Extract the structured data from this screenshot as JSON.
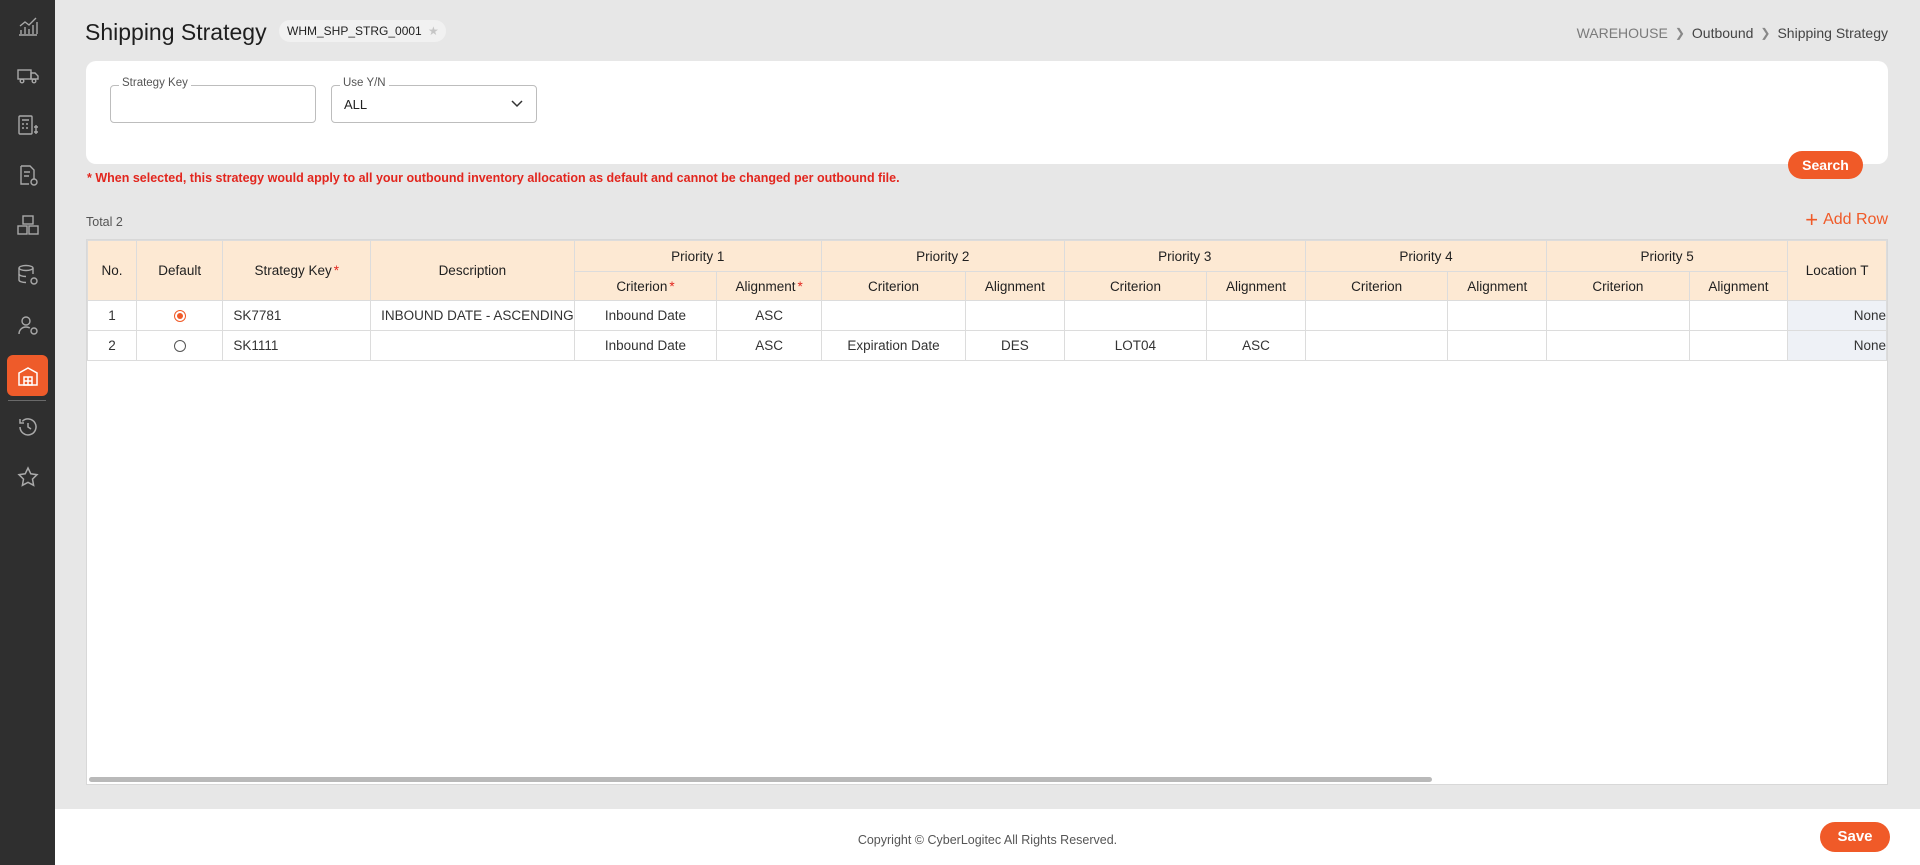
{
  "sidebar": {
    "items": [
      {
        "icon": "analytics-chart-icon"
      },
      {
        "icon": "truck-icon"
      },
      {
        "icon": "billing-calculator-icon"
      },
      {
        "icon": "document-settings-icon"
      },
      {
        "icon": "inventory-boxes-icon"
      },
      {
        "icon": "database-settings-icon"
      },
      {
        "icon": "user-settings-icon"
      },
      {
        "icon": "warehouse-icon",
        "active": true
      },
      {
        "icon": "history-clock-icon"
      },
      {
        "icon": "favorite-star-icon"
      }
    ]
  },
  "header": {
    "title": "Shipping Strategy",
    "screen_code": "WHM_SHP_STRG_0001",
    "breadcrumb": [
      "WAREHOUSE",
      "Outbound",
      "Shipping Strategy"
    ]
  },
  "search": {
    "strategy_key_label": "Strategy Key",
    "strategy_key_value": "",
    "use_yn_label": "Use Y/N",
    "use_yn_value": "ALL",
    "search_button": "Search"
  },
  "note": "* When selected, this strategy would apply to all your outbound inventory allocation as default and cannot be changed per outbound file.",
  "grid": {
    "total_label": "Total 2",
    "add_row_label": "Add Row",
    "headers": {
      "no": "No.",
      "default": "Default",
      "strategy_key": "Strategy Key",
      "description": "Description",
      "priorities": [
        "Priority 1",
        "Priority 2",
        "Priority 3",
        "Priority 4",
        "Priority 5"
      ],
      "criterion": "Criterion",
      "alignment": "Alignment",
      "location": "Location T"
    },
    "rows": [
      {
        "no": "1",
        "default": true,
        "strategy_key": "SK7781",
        "description": "INBOUND DATE - ASCENDING",
        "p1c": "Inbound Date",
        "p1a": "ASC",
        "p2c": "",
        "p2a": "",
        "p3c": "",
        "p3a": "",
        "p4c": "",
        "p4a": "",
        "p5c": "",
        "p5a": "",
        "location": "None"
      },
      {
        "no": "2",
        "default": false,
        "strategy_key": "SK1111",
        "description": "",
        "p1c": "Inbound Date",
        "p1a": "ASC",
        "p2c": "Expiration Date",
        "p2a": "DES",
        "p3c": "LOT04",
        "p3a": "ASC",
        "p4c": "",
        "p4a": "",
        "p5c": "",
        "p5a": "",
        "location": "None"
      }
    ]
  },
  "footer": {
    "copyright": "Copyright © CyberLogitec All Rights Reserved.",
    "save_button": "Save"
  },
  "colors": {
    "accent": "#f05a28",
    "header_fill": "#fde9d3",
    "sidebar": "#2f2f2f",
    "required": "#e2261e"
  }
}
